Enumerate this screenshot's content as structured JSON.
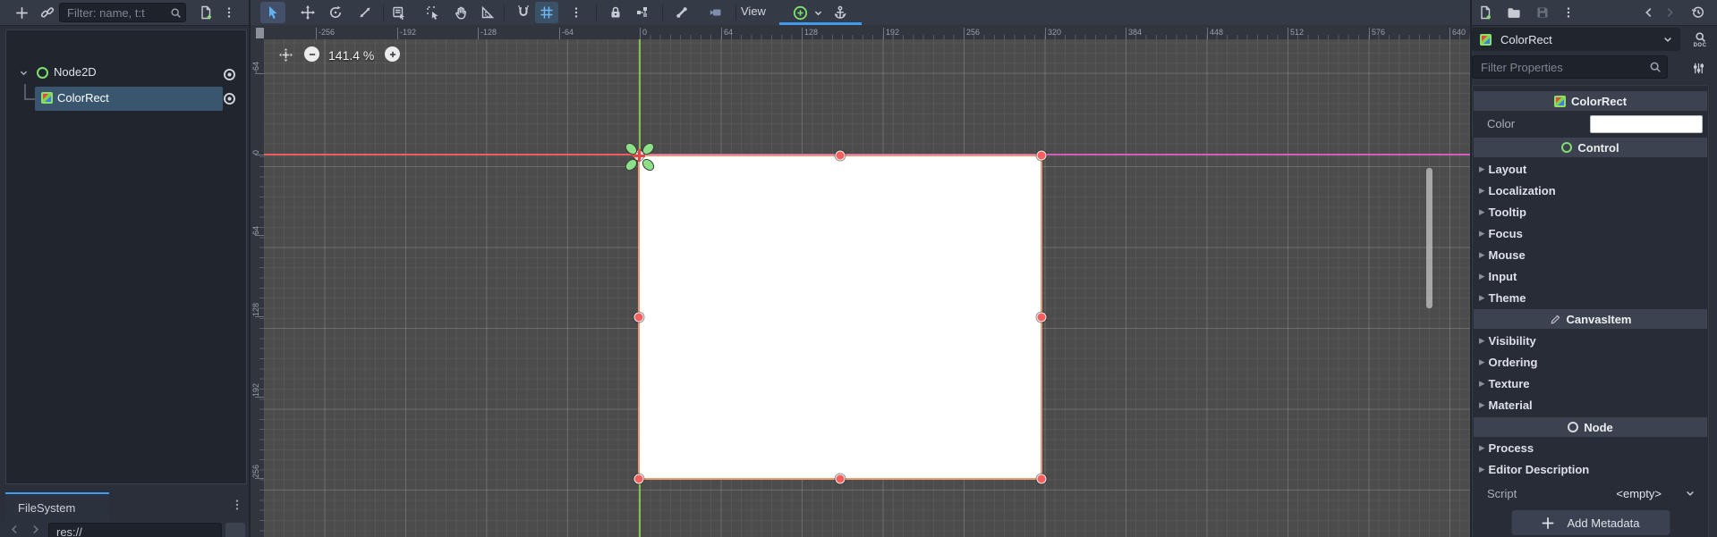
{
  "scene_dock": {
    "filter_placeholder": "Filter: name, t:t",
    "nodes": [
      {
        "name": "Node2D",
        "type": "Node2D",
        "selected": false
      },
      {
        "name": "ColorRect",
        "type": "ColorRect",
        "selected": true
      }
    ]
  },
  "canvas_toolbar": {
    "view_label": "View"
  },
  "canvas": {
    "zoom_label": "141.4 %",
    "h_ruler": [
      "-256",
      "-192",
      "-128",
      "-64",
      "0",
      "64",
      "128",
      "192",
      "256",
      "320",
      "384",
      "448",
      "512",
      "576",
      "640"
    ],
    "v_ruler": [
      "-64",
      "0",
      "64",
      "128",
      "192",
      "256"
    ]
  },
  "filesystem": {
    "tab_label": "FileSystem",
    "path": "res://"
  },
  "inspector": {
    "node_name": "ColorRect",
    "filter_placeholder": "Filter Properties",
    "doc_badge": "DOC",
    "sections": {
      "colorrect": {
        "header": "ColorRect",
        "color_label": "Color"
      },
      "control": {
        "header": "Control",
        "items": [
          "Layout",
          "Localization",
          "Tooltip",
          "Focus",
          "Mouse",
          "Input",
          "Theme"
        ]
      },
      "canvasitem": {
        "header": "CanvasItem",
        "items": [
          "Visibility",
          "Ordering",
          "Texture",
          "Material"
        ]
      },
      "node": {
        "header": "Node",
        "items": [
          "Process",
          "Editor Description"
        ]
      }
    },
    "script_label": "Script",
    "script_value": "<empty>",
    "add_metadata_label": "Add Metadata"
  },
  "colors": {
    "accent_blue": "#3f9bf0",
    "selection_blue": "#3a566f",
    "canvas_bg": "#4c4c4c",
    "selected_rect_border": "#e89b72",
    "selected_rect_fill": "#ffffff",
    "axis_x_red": "#ff5f5f",
    "axis_y_green": "#8fce4e",
    "viewport_border_magenta": "#e060c8",
    "handle_red": "#f55f5f",
    "anchor_gizmo_green": "#8ce08a",
    "color_property_value": "#ffffff"
  }
}
